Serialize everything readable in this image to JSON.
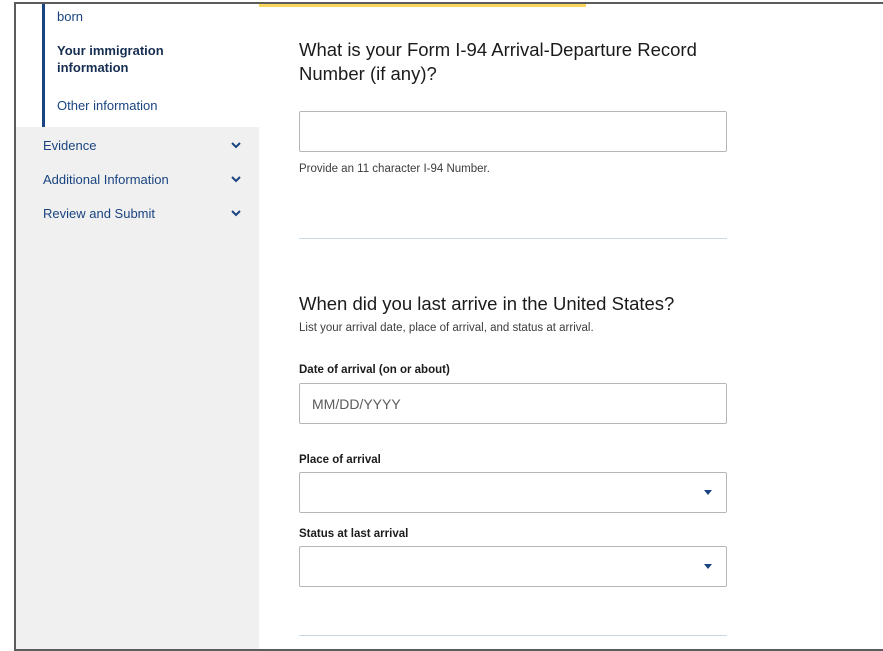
{
  "sidebar": {
    "sub_items": [
      {
        "label": "born"
      },
      {
        "label": "Your immigration information"
      },
      {
        "label": "Other information"
      }
    ],
    "nav_items": [
      {
        "label": "Evidence",
        "icon": "chevron-down-icon"
      },
      {
        "label": "Additional Information",
        "icon": "chevron-down-icon"
      },
      {
        "label": "Review and Submit",
        "icon": "chevron-down-icon"
      }
    ]
  },
  "form": {
    "i94": {
      "title": "What is your Form I-94 Arrival-Departure Record Number (if any)?",
      "value": "",
      "hint": "Provide an 11 character I-94 Number."
    },
    "arrival": {
      "title": "When did you last arrive in the United States?",
      "description": "List your arrival date, place of arrival, and status at arrival.",
      "date_label": "Date of arrival (on or about)",
      "date_placeholder": "MM/DD/YYYY",
      "place_label": "Place of arrival",
      "place_value": "",
      "status_label": "Status at last arrival",
      "status_value": ""
    }
  },
  "colors": {
    "link": "#1a4480",
    "active": "#162e51",
    "sidebar_bg": "#f0f0f0",
    "accent": "#f4d03f"
  }
}
